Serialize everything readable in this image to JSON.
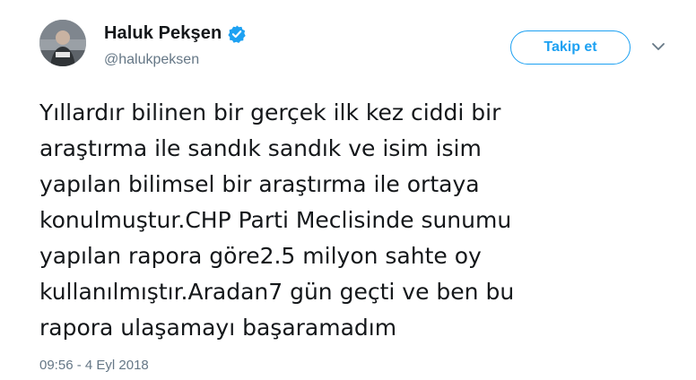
{
  "author": {
    "display_name": "Haluk Pekşen",
    "handle": "@halukpeksen",
    "verified": true,
    "avatar_icon": "profile-photo"
  },
  "actions": {
    "follow_label": "Takip et",
    "more_icon": "chevron-down-icon"
  },
  "tweet": {
    "lines": [
      "Yıllardır bilinen bir gerçek ilk kez ciddi bir",
      "araştırma ile sandık sandık ve isim isim",
      "yapılan bilimsel bir araştırma ile ortaya",
      "konulmuştur.CHP Parti Meclisinde sunumu",
      "yapılan rapora göre2.5 milyon sahte oy",
      "kullanılmıştır.Aradan7 gün geçti ve ben bu",
      "rapora ulaşamayı başaramadım"
    ],
    "timestamp": "09:56 - 4 Eyl 2018"
  },
  "colors": {
    "accent": "#1da1f2",
    "text": "#14171a",
    "muted": "#657786"
  }
}
